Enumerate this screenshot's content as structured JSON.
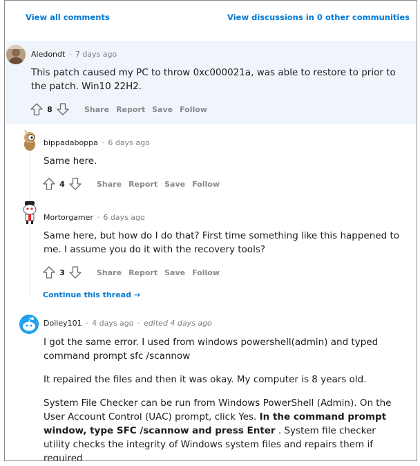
{
  "top": {
    "view_all": "View all comments",
    "view_discussions": "View discussions in 0 other communities"
  },
  "comments": [
    {
      "user": "Aledondt",
      "time": "7 days ago",
      "paragraphs": [
        "This patch caused my PC to throw 0xc000021a, was able to restore to prior to the patch. Win10 22H2."
      ],
      "votes": "8"
    },
    {
      "user": "bippadaboppa",
      "time": "6 days ago",
      "paragraphs": [
        "Same here."
      ],
      "votes": "4"
    },
    {
      "user": "Mortorgamer",
      "time": "6 days ago",
      "paragraphs": [
        "Same here, but how do I do that? First time something like this happened to me. I assume you do it with the recovery tools?"
      ],
      "votes": "3"
    },
    {
      "user": "Doiley101",
      "time": "4 days ago",
      "edited": "edited 4 days ago",
      "paragraphs": [
        "I got the same error. I used from windows powershell(admin) and typed command prompt sfc /scannow",
        "It repaired the files and then it was okay. My computer is 8 years old."
      ],
      "para3_start": "System File Checker can be run from Windows PowerShell (Admin). On the User Account Control (UAC) prompt, click Yes.",
      "para3_bold": "In the command prompt window, type SFC /scannow and press Enter",
      "para3_end": ". System file checker utility checks the integrity of Windows system files and repairs them if required"
    }
  ],
  "actions": {
    "share": "Share",
    "report": "Report",
    "save": "Save",
    "follow": "Follow"
  },
  "continue_thread": "Continue this thread →",
  "separator": "·",
  "colors": {
    "link": "#0079d3",
    "highlight_bg": "#f0f5fb",
    "muted": "#878a8c"
  },
  "icons": {
    "upvote": "arrow-up-outline",
    "downvote": "arrow-down-outline"
  }
}
